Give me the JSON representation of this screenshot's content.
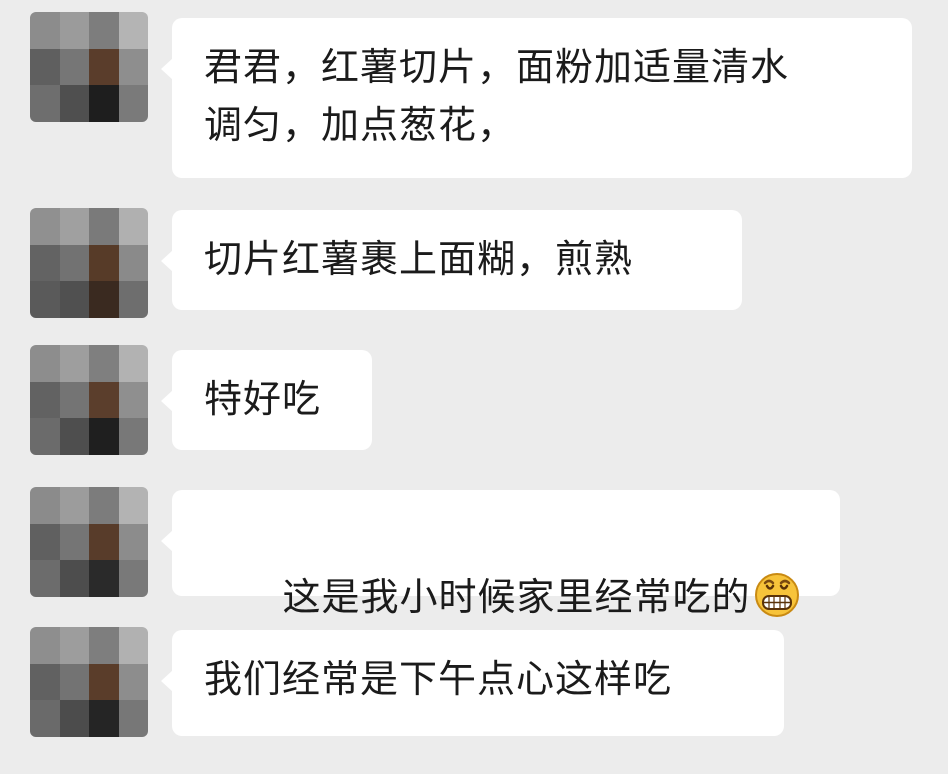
{
  "chat": {
    "messages": [
      {
        "text": "君君，红薯切片，面粉加适量清水\n调匀，加点葱花，",
        "emoji": null
      },
      {
        "text": "切片红薯裹上面糊，煎熟",
        "emoji": null
      },
      {
        "text": "特好吃",
        "emoji": null
      },
      {
        "text": "这是我小时候家里经常吃的",
        "emoji": "grinning-face-icon"
      },
      {
        "text": "我们经常是下午点心这样吃",
        "emoji": null
      }
    ]
  },
  "colors": {
    "background": "#ececec",
    "bubble": "#ffffff",
    "text": "#1b1b1b",
    "emoji_face": "#f7c33a"
  }
}
